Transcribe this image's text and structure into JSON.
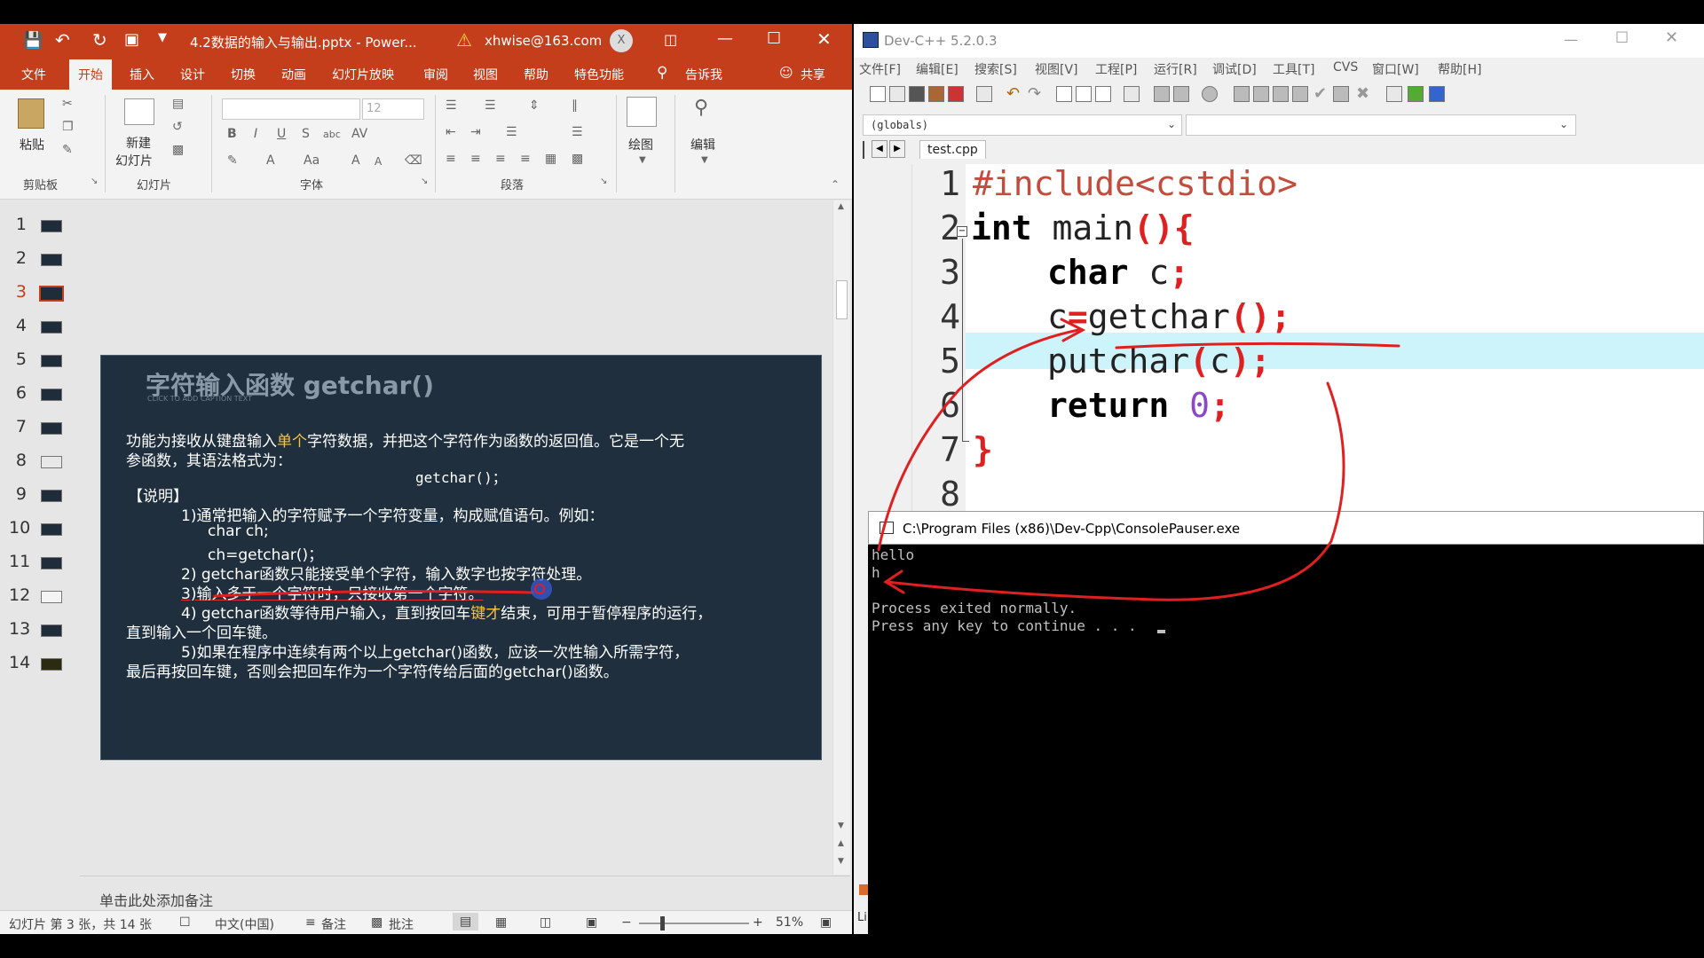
{
  "ppt": {
    "filename": "4.2数据的输入与输出.pptx - Power...",
    "account": "xhwise@163.com",
    "avatar_letter": "X",
    "tabs": [
      "文件",
      "开始",
      "插入",
      "设计",
      "切换",
      "动画",
      "幻灯片放映",
      "审阅",
      "视图",
      "帮助",
      "特色功能",
      "告诉我",
      "共享"
    ],
    "ribbon": {
      "paste": "粘贴",
      "new_slide_1": "新建",
      "new_slide_2": "幻灯片",
      "font_size": "12",
      "draw": "绘图",
      "edit": "编辑",
      "groups": [
        "剪贴板",
        "幻灯片",
        "字体",
        "段落"
      ]
    },
    "thumbnails": [
      "1",
      "2",
      "3",
      "4",
      "5",
      "6",
      "7",
      "8",
      "9",
      "10",
      "11",
      "12",
      "13",
      "14"
    ],
    "slide": {
      "title": "字符输入函数 getchar()",
      "caption": "CLICK TO ADD CAPTION TEXT",
      "l1a": "功能为接收从键盘输入",
      "l1b": "单个",
      "l1c": "字符数据，并把这个字符作为函数的返回值。它是一个无",
      "l2": "参函数，其语法格式为：",
      "syntax": "getchar()；",
      "note_hdr": "【说明】",
      "p1": "1)通常把输入的字符赋予一个字符变量，构成赋值语句。例如：",
      "p1a": "char   ch;",
      "p1b": "ch=getchar()；",
      "p2": "2) getchar函数只能接受单个字符，输入数字也按字符处理。",
      "p3": "3)输入多于一个字符时，只接收第一个字符。",
      "p4a": "4) getchar函数等待用户输入，直到按回车",
      "p4b": "键才",
      "p4c": "结束，可用于暂停程序的运行，",
      "p4d": "直到输入一个回车键。",
      "p5": "5)如果在程序中连续有两个以上getchar()函数，应该一次性输入所需字符，",
      "p5b": "最后再按回车键，否则会把回车作为一个字符传给后面的getchar()函数。"
    },
    "notes_placeholder": "单击此处添加备注",
    "status": {
      "slide_info": "幻灯片 第 3 张，共 14 张",
      "language": "中文(中国)",
      "notes": "备注",
      "comments": "批注",
      "zoom": "51%"
    }
  },
  "dev": {
    "title": "Dev-C++ 5.2.0.3",
    "menu": [
      "文件[F]",
      "编辑[E]",
      "搜索[S]",
      "视图[V]",
      "工程[P]",
      "运行[R]",
      "调试[D]",
      "工具[T]",
      "CVS",
      "窗口[W]",
      "帮助[H]"
    ],
    "scope_combo": "(globals)",
    "file_tab": "test.cpp",
    "line_numbers": [
      "1",
      "2",
      "3",
      "4",
      "5",
      "6",
      "7",
      "8"
    ],
    "code": {
      "l1": "#include<cstdio>",
      "l2_kw": "int",
      "l2_rest": " main",
      "l2_sym": "(){",
      "l3_kw": "char",
      "l3_rest": " c",
      "l3_sym": ";",
      "l4_a": "c",
      "l4_b": "=",
      "l4_c": "getchar",
      "l4_d": "();",
      "l5_a": "putchar",
      "l5_b": "(",
      "l5_c": "c",
      "l5_d": ");",
      "l6_kw": "return",
      "l6_num": "0",
      "l6_sym": ";",
      "l7": "}"
    },
    "status_text": "Lin"
  },
  "console": {
    "title": "C:\\Program Files (x86)\\Dev-Cpp\\ConsolePauser.exe",
    "lines": [
      "hello",
      "h",
      "",
      "Process exited normally.",
      "Press any key to continue . . . "
    ]
  },
  "colors": {
    "ppt_accent": "#c43e1c",
    "slide_bg": "#1f2f3e",
    "highlight_line": "#cdf4fb",
    "annotation": "#e02020"
  }
}
